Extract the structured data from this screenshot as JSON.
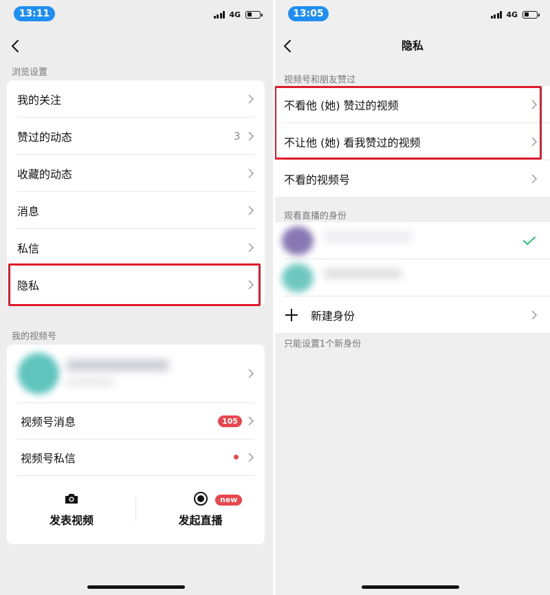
{
  "left": {
    "time": "13:11",
    "network": "4G",
    "section_browse": "浏览设置",
    "browse_items": [
      {
        "label": "我的关注"
      },
      {
        "label": "赞过的动态",
        "count": "3"
      },
      {
        "label": "收藏的动态"
      },
      {
        "label": "消息"
      },
      {
        "label": "私信"
      },
      {
        "label": "隐私"
      }
    ],
    "section_channels": "我的视频号",
    "channel_items": {
      "messages": {
        "label": "视频号消息",
        "badge": "105"
      },
      "private_messages": {
        "label": "视频号私信"
      }
    },
    "actions": {
      "post_video": "发表视频",
      "start_live": "发起直播",
      "new_badge": "new"
    }
  },
  "right": {
    "time": "13:05",
    "network": "4G",
    "title": "隐私",
    "section_likes": "视频号和朋友赞过",
    "like_items": [
      {
        "label": "不看他 (她) 赞过的视频"
      },
      {
        "label": "不让他 (她) 看我赞过的视频"
      },
      {
        "label": "不看的视频号"
      }
    ],
    "section_identity": "观看直播的身份",
    "new_identity": "新建身份",
    "footnote": "只能设置1个新身份"
  },
  "colors": {
    "highlight": "#e01a2b",
    "badge": "#e8484d",
    "time_pill": "#1f8ef1",
    "check": "#07c160"
  }
}
